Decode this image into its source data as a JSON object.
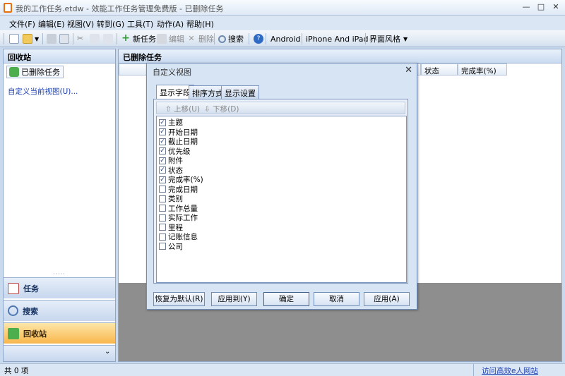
{
  "window": {
    "title": "我的工作任务.etdw - 效能工作任务管理免费版 - 已删除任务",
    "min": "—",
    "max": "□",
    "close": "✕"
  },
  "menu": [
    "文件(F)",
    "编辑(E)",
    "视图(V)",
    "转到(G)",
    "工具(T)",
    "动作(A)",
    "帮助(H)"
  ],
  "toolbar": {
    "new_task": "新任务",
    "edit": "编辑",
    "delete": "删除",
    "search": "搜索",
    "android": "Android",
    "iphone": "iPhone And iPad",
    "theme": "界面风格"
  },
  "left_panel": {
    "header": "回收站",
    "tree_item": "已删除任务",
    "custom_view_link": "自定义当前视图(U)...",
    "splitter": "·····",
    "nav": {
      "tasks": "任务",
      "search": "搜索",
      "recycle": "回收站",
      "footer_chevron": "⌄"
    }
  },
  "main": {
    "header": "已删除任务",
    "columns": {
      "status": "状态",
      "completion": "完成率(%)"
    }
  },
  "statusbar": {
    "count": "共 0 项",
    "link": "访问高效e人网站"
  },
  "dialog": {
    "title": "自定义视图",
    "close": "✕",
    "tabs": [
      "显示字段",
      "排序方式",
      "显示设置"
    ],
    "move_up": "上移(U)",
    "move_down": "下移(D)",
    "fields": [
      {
        "label": "主题",
        "checked": true
      },
      {
        "label": "开始日期",
        "checked": true
      },
      {
        "label": "截止日期",
        "checked": true
      },
      {
        "label": "优先级",
        "checked": true
      },
      {
        "label": "附件",
        "checked": true
      },
      {
        "label": "状态",
        "checked": true
      },
      {
        "label": "完成率(%)",
        "checked": true
      },
      {
        "label": "完成日期",
        "checked": false
      },
      {
        "label": "类别",
        "checked": false
      },
      {
        "label": "工作总量",
        "checked": false
      },
      {
        "label": "实际工作",
        "checked": false
      },
      {
        "label": "里程",
        "checked": false
      },
      {
        "label": "记账信息",
        "checked": false
      },
      {
        "label": "公司",
        "checked": false
      }
    ],
    "buttons": {
      "reset": "恢复为默认(R)",
      "apply_to": "应用到(Y)",
      "ok": "确定",
      "cancel": "取消",
      "apply": "应用(A)"
    }
  },
  "colors": {
    "accent": "#f8b64c",
    "header_bg": "#c9daf0",
    "link": "#1b3fb0"
  }
}
